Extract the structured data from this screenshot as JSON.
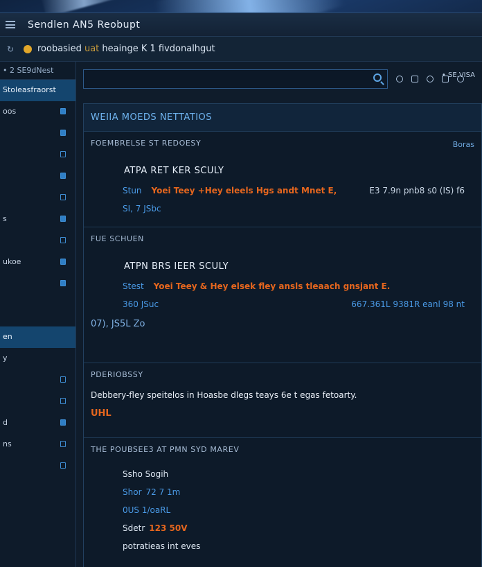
{
  "app": {
    "title": "Sendlen AN5 Reobupt"
  },
  "address_bar": {
    "back_label": "↻",
    "url_prefix": "roobasied",
    "url_muted": " uat",
    "url_rest": " heainge K 1 fivdonalhgut"
  },
  "status": {
    "label": "• SE.VISA"
  },
  "sidebar": {
    "header": "• 2 SE9dNest",
    "subheader": "Stoleasfraorst",
    "items": [
      {
        "label": "oos",
        "marker": "filled"
      },
      {
        "label": "",
        "marker": "filled"
      },
      {
        "label": "",
        "marker": "outline"
      },
      {
        "label": "",
        "marker": "filled"
      },
      {
        "label": "",
        "marker": "outline"
      },
      {
        "label": "s",
        "marker": "filled"
      },
      {
        "label": "",
        "marker": "outline"
      },
      {
        "label": "ukoe",
        "marker": "filled"
      },
      {
        "label": "",
        "marker": "filled"
      },
      {
        "label": "en",
        "marker": "none"
      },
      {
        "label": "y",
        "marker": "none"
      },
      {
        "label": "",
        "marker": "outline"
      },
      {
        "label": "",
        "marker": "outline"
      },
      {
        "label": "d",
        "marker": "filled"
      },
      {
        "label": "ns",
        "marker": "outline"
      },
      {
        "label": "",
        "marker": "outline"
      }
    ]
  },
  "main": {
    "panel_title": "WEIIA MOEDS NETTATIOS",
    "sections": [
      {
        "title": "FOEMBRELSE ST REDOESY",
        "tag": "Boras",
        "heading": "ATPA RET KER SCULY",
        "detail_label": "Stun",
        "detail_orange": "Yoei Teey +Hey eleels Hgs andt Mnet E,",
        "detail_right": "E3 7.9n pnb8 s0 (IS) f6",
        "sub": "SI, 7 JSbc"
      },
      {
        "title": "FUE SCHUEN",
        "heading": "ATPN BRS IEER SCULY",
        "detail_label": "Stest",
        "detail_orange": "Yoei Teey & Hey elsek fley ansls tleaach gnsjant E.",
        "sub": "360 JSuc",
        "sub_right": "667.361L 9381R eanl 98 nt",
        "foot": "07), JS5L Zo"
      },
      {
        "title": "PDERIOBSSY",
        "paragraph": "Debbery-fley speitelos in Hoasbe dlegs teays 6e t egas fetoarty.",
        "strong": "UHL"
      },
      {
        "title": "THE POUBSEE3 AT PMN SYD MAREV",
        "rows": [
          {
            "key": "Ssho Sogih",
            "value": "",
            "key_style": "plain",
            "value_style": "blue"
          },
          {
            "key": "Shor",
            "value": "72 7 1m",
            "key_style": "blue",
            "value_style": "blue"
          },
          {
            "key": "0US 1/oaRL",
            "value": "",
            "key_style": "blue",
            "value_style": "blue"
          },
          {
            "key": "Sdetr",
            "value": "123 50V",
            "key_style": "plain",
            "value_style": "orange"
          },
          {
            "key": "potratieas int eves",
            "value": "",
            "key_style": "plain",
            "value_style": "blue"
          }
        ]
      }
    ]
  },
  "colors": {
    "accent_blue": "#4a9ae6",
    "accent_orange": "#e5661e",
    "panel_bg": "#0d1a29",
    "active_item": "#14456e"
  }
}
